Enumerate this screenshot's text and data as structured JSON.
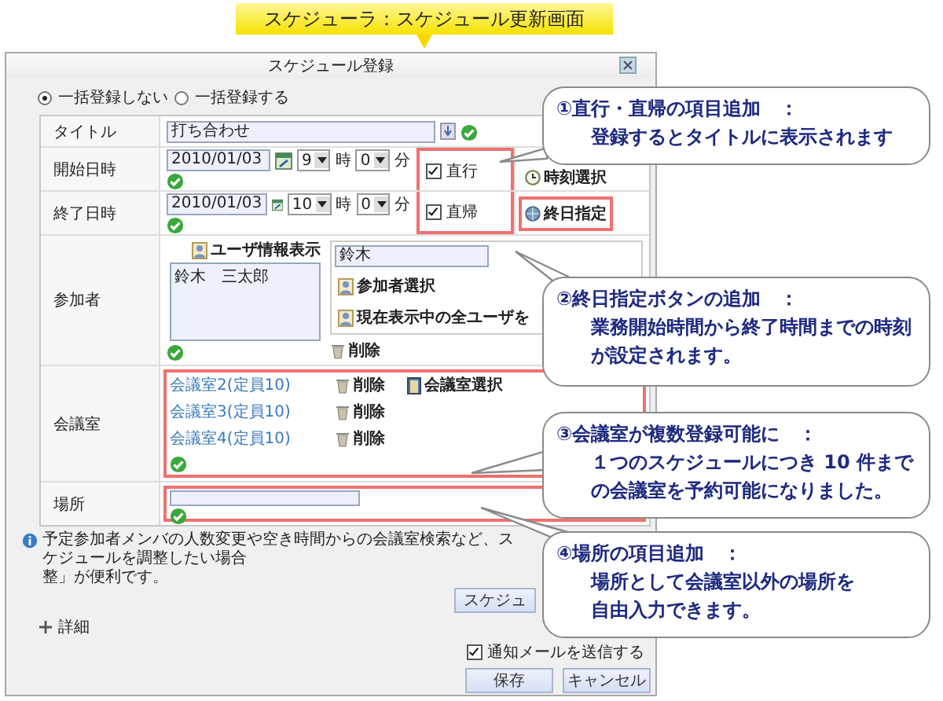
{
  "banner": {
    "title": "スケジューラ：スケジュール更新画面"
  },
  "dialog": {
    "title": "スケジュール登録",
    "bulk_options": [
      {
        "label": "一括登録しない",
        "selected": true
      },
      {
        "label": "一括登録する",
        "selected": false
      }
    ],
    "title_row": {
      "label": "タイトル",
      "value": "打ち合わせ"
    },
    "time_rows": [
      {
        "label": "開始日時",
        "date": "2010/01/03",
        "hour": "9",
        "hour_unit": "時",
        "minute": "0",
        "minute_unit": "分",
        "check_label": "直行",
        "checked": true
      },
      {
        "label": "終了日時",
        "date": "2010/01/03",
        "hour": "10",
        "hour_unit": "時",
        "minute": "0",
        "minute_unit": "分",
        "check_label": "直帰",
        "checked": true
      }
    ],
    "time_select_button": "時刻選択",
    "all_day_button": "終日指定",
    "participants": {
      "label": "参加者",
      "user_info_button": "ユーザ情報表示",
      "members": [
        "鈴木　三太郎"
      ],
      "search_value": "鈴木",
      "select_button": "参加者選択",
      "all_users_button": "現在表示中の全ユーザを",
      "delete_button": "削除"
    },
    "rooms": {
      "label": "会議室",
      "items": [
        {
          "name": "会議室2(定員10)",
          "delete_button": "削除"
        },
        {
          "name": "会議室3(定員10)",
          "delete_button": "削除"
        },
        {
          "name": "会議室4(定員10)",
          "delete_button": "削除"
        }
      ],
      "select_button": "会議室選択"
    },
    "place": {
      "label": "場所"
    },
    "info_lines": [
      "予定参加者メンバの人数変更や空き時間からの会議室検索など、スケジュールを調整したい場合",
      "整」が便利です。"
    ],
    "schedule_button": "スケジュ",
    "details_label": "詳細",
    "notify": {
      "label": "通知メールを送信する",
      "checked": true
    },
    "save_button": "保存",
    "cancel_button": "キャンセル"
  },
  "callouts": [
    {
      "heading": "①直行・直帰の項目追加　：",
      "body_lines": [
        "登録するとタイトルに表示されます"
      ]
    },
    {
      "heading": "②終日指定ボタンの追加　：",
      "body_lines": [
        "業務開始時間から終了時間までの時刻",
        "が設定されます。"
      ]
    },
    {
      "heading": "③会議室が複数登録可能に　：",
      "body_lines": [
        "１つのスケジュールにつき 10 件まで",
        "の会議室を予約可能になりました。"
      ]
    },
    {
      "heading": "④場所の項目追加　：",
      "body_lines": [
        "場所として会議室以外の場所を",
        "自由入力できます。"
      ]
    }
  ]
}
